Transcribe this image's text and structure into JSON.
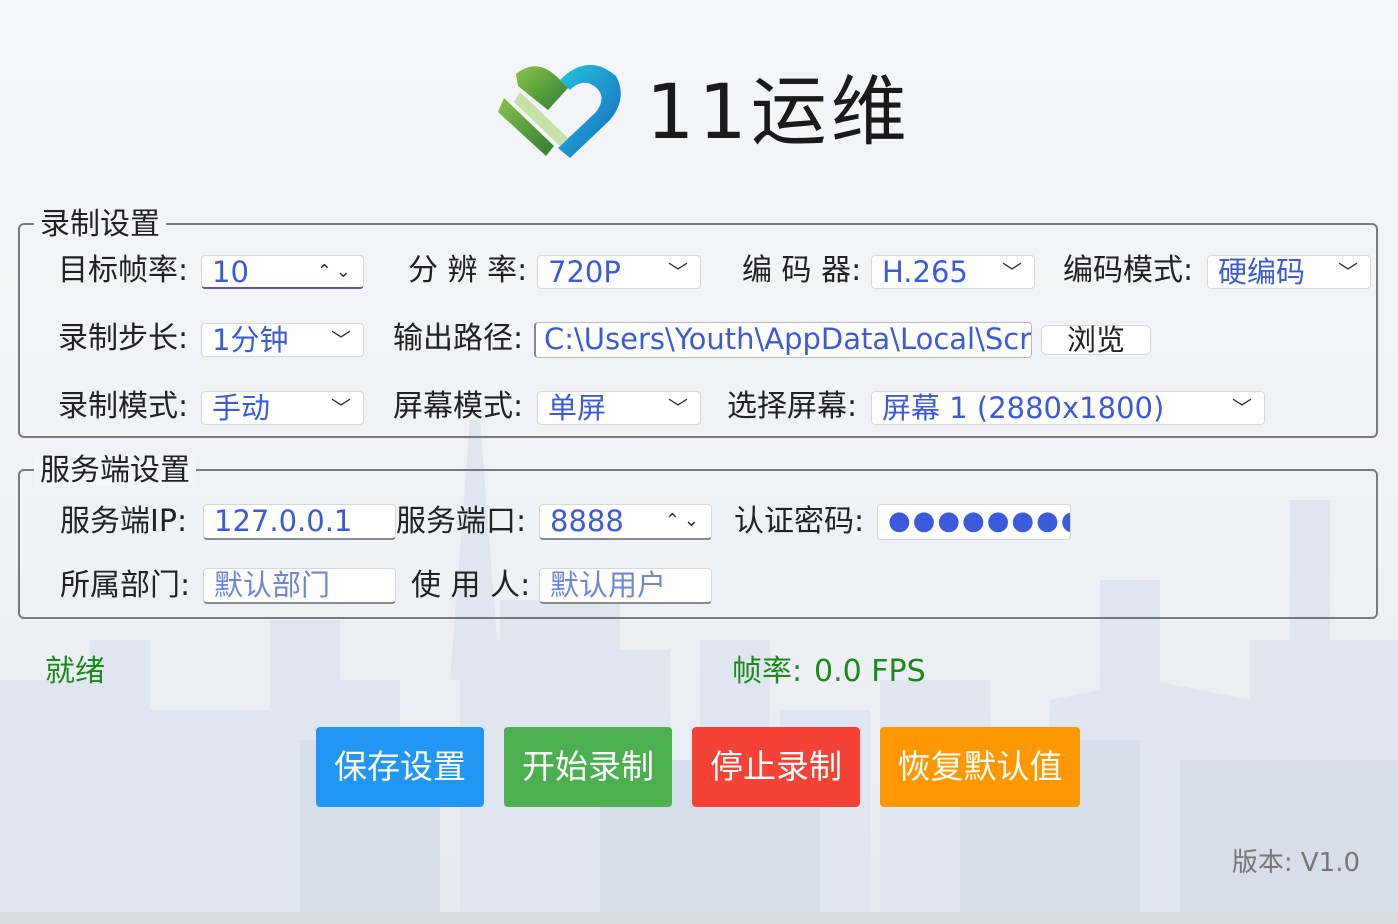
{
  "app": {
    "logo_text": "11运维",
    "version": "版本: V1.0"
  },
  "recording": {
    "title": "录制设置",
    "fps": {
      "label": "目标帧率:",
      "value": "10"
    },
    "resolution": {
      "label": "分 辨 率:",
      "value": "720P"
    },
    "encoder": {
      "label": "编 码 器:",
      "value": "H.265"
    },
    "encode_mode": {
      "label": "编码模式:",
      "value": "硬编码"
    },
    "step": {
      "label": "录制步长:",
      "value": "1分钟"
    },
    "output_path": {
      "label": "输出路径:",
      "value": "C:\\Users\\Youth\\AppData\\Local\\Scr"
    },
    "browse_label": "浏览",
    "record_mode": {
      "label": "录制模式:",
      "value": "手动"
    },
    "screen_mode": {
      "label": "屏幕模式:",
      "value": "单屏"
    },
    "select_screen": {
      "label": "选择屏幕:",
      "value": "屏幕 1 (2880x1800)"
    }
  },
  "server": {
    "title": "服务端设置",
    "ip": {
      "label": "服务端IP:",
      "value": "127.0.0.1"
    },
    "port": {
      "label": "服务端口:",
      "value": "8888"
    },
    "password": {
      "label": "认证密码:",
      "value": "●●●●●●●●"
    },
    "department": {
      "label": "所属部门:",
      "placeholder": "默认部门"
    },
    "user": {
      "label": "使 用 人:",
      "placeholder": "默认用户"
    }
  },
  "status": {
    "state": "就绪",
    "fps_label": "帧率:",
    "fps_value": "0.0 FPS"
  },
  "buttons": {
    "save": "保存设置",
    "start": "开始录制",
    "stop": "停止录制",
    "reset": "恢复默认值"
  },
  "colors": {
    "save": "#2196f3",
    "start": "#4caf50",
    "stop": "#f44336",
    "reset": "#ff9800",
    "status_text": "#1a8a1a",
    "field_text": "#3b5bdb"
  },
  "icons": {
    "dropdown": "chevron-down-icon",
    "spinner": "spinner-arrows-icon",
    "logo": "heart-logo-icon"
  }
}
